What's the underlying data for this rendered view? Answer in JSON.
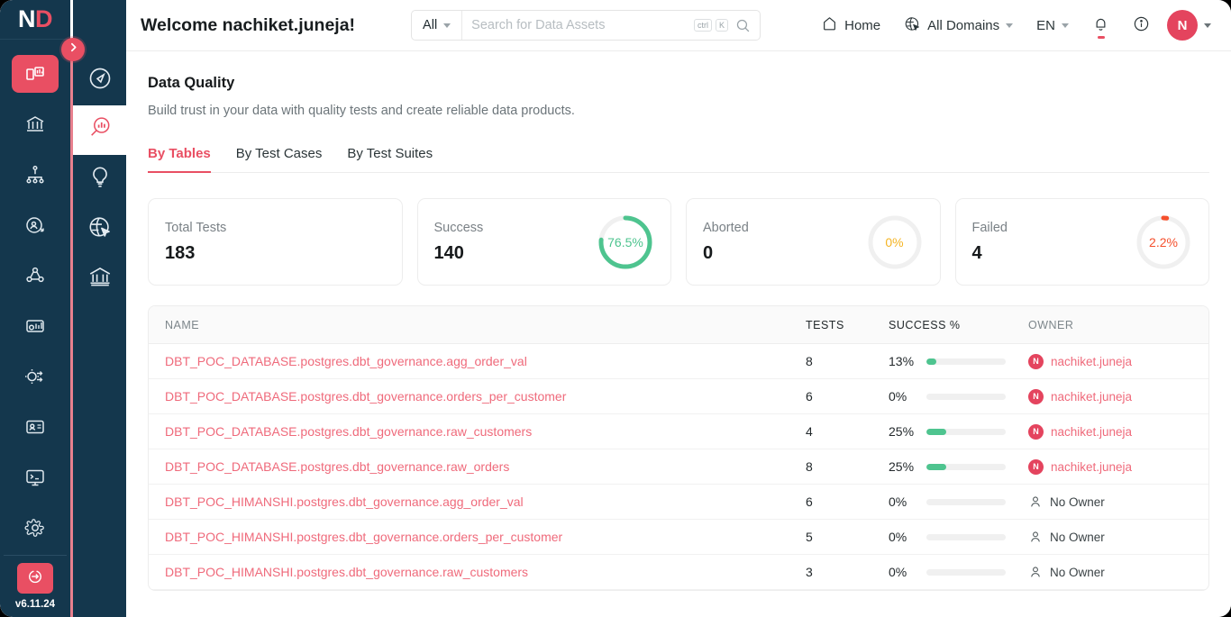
{
  "brand": {
    "part1": "ND",
    "first": "N",
    "second": "D"
  },
  "primary_sidebar": {
    "items": [
      {
        "name": "dashboard",
        "icon": "dashboard-icon",
        "active": true
      },
      {
        "name": "explore",
        "icon": "bank-icon",
        "active": false
      },
      {
        "name": "lineage",
        "icon": "hierarchy-icon",
        "active": false
      },
      {
        "name": "insights",
        "icon": "user-search-icon",
        "active": false
      },
      {
        "name": "governance",
        "icon": "network-nodes-icon",
        "active": false
      },
      {
        "name": "quality",
        "icon": "settings-chart-icon",
        "active": false
      },
      {
        "name": "pipelines",
        "icon": "gear-flow-icon",
        "active": false
      },
      {
        "name": "glossary",
        "icon": "id-card-icon",
        "active": false
      },
      {
        "name": "console",
        "icon": "terminal-icon",
        "active": false
      },
      {
        "name": "settings",
        "icon": "gear-icon",
        "active": false
      }
    ],
    "logout_icon": "logout-icon",
    "version": "v6.11.24",
    "collapse_icon": "chevron-right-icon"
  },
  "secondary_sidebar": {
    "items": [
      {
        "name": "discover",
        "icon": "compass-icon",
        "active": false
      },
      {
        "name": "data-quality",
        "icon": "data-quality-search-icon",
        "active": true
      },
      {
        "name": "insights",
        "icon": "lightbulb-icon",
        "active": false
      },
      {
        "name": "domains",
        "icon": "globe-cursor-icon",
        "active": false
      },
      {
        "name": "governance",
        "icon": "bank-icon",
        "active": false
      }
    ]
  },
  "header": {
    "welcome": "Welcome nachiket.juneja!",
    "search": {
      "scope_label": "All",
      "placeholder": "Search for Data Assets",
      "kbd_ctrl": "ctrl",
      "kbd_key": "K",
      "search_icon": "search-icon",
      "chevron_icon": "chevron-down-icon"
    },
    "home_label": "Home",
    "home_icon": "home-icon",
    "domains_label": "All Domains",
    "domains_icon": "globe-cursor-icon",
    "language_label": "EN",
    "bell_icon": "bell-icon",
    "info_icon": "info-circle-icon",
    "avatar_initial": "N"
  },
  "main": {
    "title": "Data Quality",
    "subtitle": "Build trust in your data with quality tests and create reliable data products.",
    "tabs": [
      {
        "label": "By Tables",
        "active": true
      },
      {
        "label": "By Test Cases",
        "active": false
      },
      {
        "label": "By Test Suites",
        "active": false
      }
    ],
    "cards": [
      {
        "label": "Total Tests",
        "value": "183",
        "percent_label": null,
        "percent": null,
        "color": null,
        "has_donut": false
      },
      {
        "label": "Success",
        "value": "140",
        "percent_label": "76.5%",
        "percent": 76.5,
        "color": "#4ec48f",
        "has_donut": true
      },
      {
        "label": "Aborted",
        "value": "0",
        "percent_label": "0%",
        "percent": 0,
        "color": "#f5b423",
        "has_donut": true
      },
      {
        "label": "Failed",
        "value": "4",
        "percent_label": "2.2%",
        "percent": 2.2,
        "color": "#f5502d",
        "has_donut": true
      }
    ],
    "table": {
      "columns": [
        "NAME",
        "TESTS",
        "SUCCESS %",
        "OWNER"
      ],
      "rows": [
        {
          "name": "DBT_POC_DATABASE.postgres.dbt_governance.agg_order_val",
          "tests": "8",
          "success": "13%",
          "success_pct": 13,
          "owner": "nachiket.juneja",
          "owner_initial": "N",
          "has_owner": true
        },
        {
          "name": "DBT_POC_DATABASE.postgres.dbt_governance.orders_per_customer",
          "tests": "6",
          "success": "0%",
          "success_pct": 0,
          "owner": "nachiket.juneja",
          "owner_initial": "N",
          "has_owner": true
        },
        {
          "name": "DBT_POC_DATABASE.postgres.dbt_governance.raw_customers",
          "tests": "4",
          "success": "25%",
          "success_pct": 25,
          "owner": "nachiket.juneja",
          "owner_initial": "N",
          "has_owner": true
        },
        {
          "name": "DBT_POC_DATABASE.postgres.dbt_governance.raw_orders",
          "tests": "8",
          "success": "25%",
          "success_pct": 25,
          "owner": "nachiket.juneja",
          "owner_initial": "N",
          "has_owner": true
        },
        {
          "name": "DBT_POC_HIMANSHI.postgres.dbt_governance.agg_order_val",
          "tests": "6",
          "success": "0%",
          "success_pct": 0,
          "owner": "No Owner",
          "owner_initial": "",
          "has_owner": false
        },
        {
          "name": "DBT_POC_HIMANSHI.postgres.dbt_governance.orders_per_customer",
          "tests": "5",
          "success": "0%",
          "success_pct": 0,
          "owner": "No Owner",
          "owner_initial": "",
          "has_owner": false
        },
        {
          "name": "DBT_POC_HIMANSHI.postgres.dbt_governance.raw_customers",
          "tests": "3",
          "success": "0%",
          "success_pct": 0,
          "owner": "No Owner",
          "owner_initial": "",
          "has_owner": false
        }
      ]
    }
  },
  "colors": {
    "brand_pink": "#e94f63",
    "sidebar_dark": "#14374d",
    "success_green": "#4ec48f",
    "aborted_yellow": "#f5b423",
    "failed_red": "#f5502d",
    "link_pink": "#ef6a7b"
  }
}
